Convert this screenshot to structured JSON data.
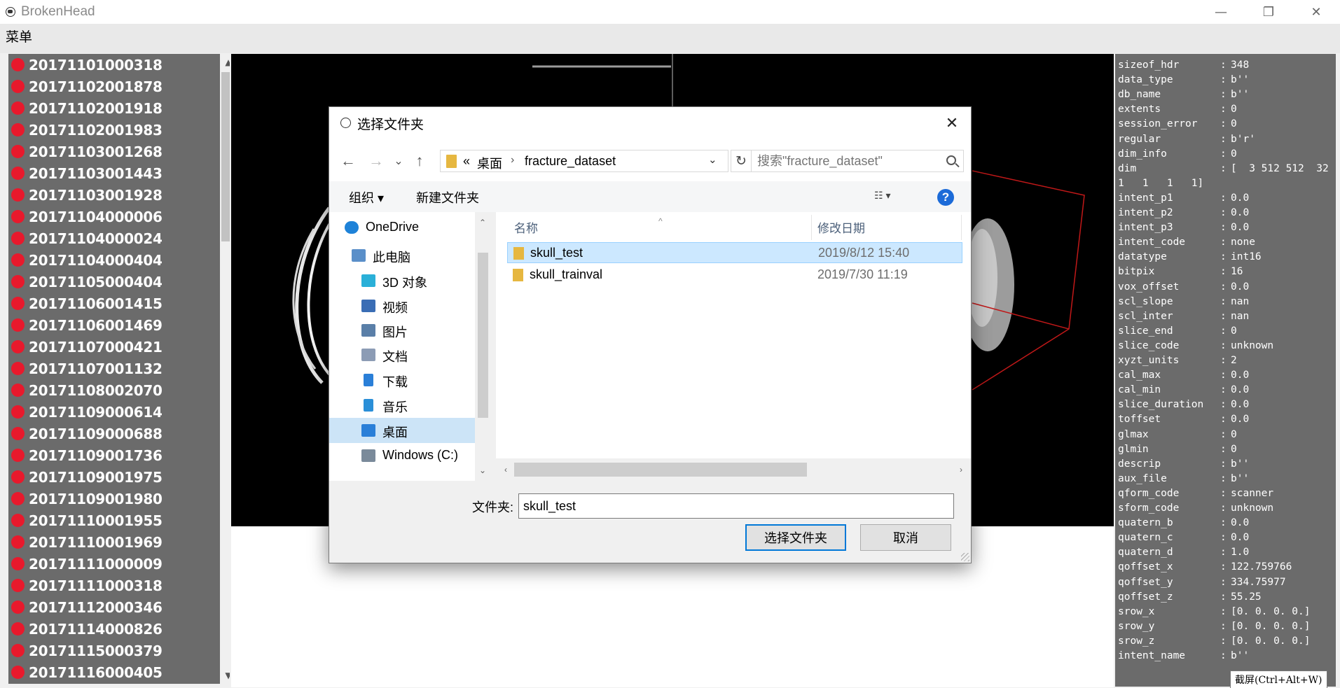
{
  "app": {
    "title": "BrokenHead"
  },
  "window_controls": {
    "minimize": "—",
    "restore": "❐",
    "close": "✕"
  },
  "menu": {
    "label": "菜单"
  },
  "case_list": [
    "20171101000318",
    "20171102001878",
    "20171102001918",
    "20171102001983",
    "20171103001268",
    "20171103001443",
    "20171103001928",
    "20171104000006",
    "20171104000024",
    "20171104000404",
    "20171105000404",
    "20171106001415",
    "20171106001469",
    "20171107000421",
    "20171107001132",
    "20171108002070",
    "20171109000614",
    "20171109000688",
    "20171109001736",
    "20171109001975",
    "20171109001980",
    "20171110001955",
    "20171110001969",
    "20171111000009",
    "20171111000318",
    "20171112000346",
    "20171114000826",
    "20171115000379",
    "20171116000405"
  ],
  "header_info": [
    {
      "k": "sizeof_hdr",
      "v": "348"
    },
    {
      "k": "data_type",
      "v": "b''"
    },
    {
      "k": "db_name",
      "v": "b''"
    },
    {
      "k": "extents",
      "v": "0"
    },
    {
      "k": "session_error",
      "v": "0"
    },
    {
      "k": "regular",
      "v": "b'r'"
    },
    {
      "k": "dim_info",
      "v": "0"
    },
    {
      "k": "dim",
      "v": "[  3 512 512  32"
    },
    {
      "k": "",
      "v": "1   1   1   1]",
      "cont": true
    },
    {
      "k": "intent_p1",
      "v": "0.0"
    },
    {
      "k": "intent_p2",
      "v": "0.0"
    },
    {
      "k": "intent_p3",
      "v": "0.0"
    },
    {
      "k": "intent_code",
      "v": "none"
    },
    {
      "k": "datatype",
      "v": "int16"
    },
    {
      "k": "bitpix",
      "v": "16"
    },
    {
      "k": "vox_offset",
      "v": "0.0"
    },
    {
      "k": "scl_slope",
      "v": "nan"
    },
    {
      "k": "scl_inter",
      "v": "nan"
    },
    {
      "k": "slice_end",
      "v": "0"
    },
    {
      "k": "slice_code",
      "v": "unknown"
    },
    {
      "k": "xyzt_units",
      "v": "2"
    },
    {
      "k": "cal_max",
      "v": "0.0"
    },
    {
      "k": "cal_min",
      "v": "0.0"
    },
    {
      "k": "slice_duration",
      "v": "0.0"
    },
    {
      "k": "toffset",
      "v": "0.0"
    },
    {
      "k": "glmax",
      "v": "0"
    },
    {
      "k": "glmin",
      "v": "0"
    },
    {
      "k": "descrip",
      "v": "b''"
    },
    {
      "k": "aux_file",
      "v": "b''"
    },
    {
      "k": "qform_code",
      "v": "scanner"
    },
    {
      "k": "sform_code",
      "v": "unknown"
    },
    {
      "k": "quatern_b",
      "v": "0.0"
    },
    {
      "k": "quatern_c",
      "v": "0.0"
    },
    {
      "k": "quatern_d",
      "v": "1.0"
    },
    {
      "k": "qoffset_x",
      "v": "122.759766"
    },
    {
      "k": "qoffset_y",
      "v": "334.75977"
    },
    {
      "k": "qoffset_z",
      "v": "55.25"
    },
    {
      "k": "srow_x",
      "v": "[0. 0. 0. 0.]"
    },
    {
      "k": "srow_y",
      "v": "[0. 0. 0. 0.]"
    },
    {
      "k": "srow_z",
      "v": "[0. 0. 0. 0.]"
    },
    {
      "k": "intent_name",
      "v": "b''"
    }
  ],
  "header_separator": ":",
  "tooltip": "截屏(Ctrl+Alt+W)",
  "dialog": {
    "title": "选择文件夹",
    "close": "✕",
    "nav": {
      "back": "←",
      "forward": "→",
      "recent": "⌄",
      "up": "↑"
    },
    "address": {
      "overflow": "«",
      "crumb1": "桌面",
      "chevron": "›",
      "crumb2": "fracture_dataset",
      "dropdown": "⌄"
    },
    "refresh": "↻",
    "search_placeholder": "搜索\"fracture_dataset\"",
    "toolbar": {
      "organize": "组织 ▾",
      "new_folder": "新建文件夹",
      "view": "☷ ▾",
      "help": "?"
    },
    "nav_pane": [
      {
        "label": "OneDrive",
        "icon": "cloud-icon"
      },
      {
        "label": "此电脑",
        "icon": "pc-icon"
      },
      {
        "label": "3D 对象",
        "icon": "cube-icon"
      },
      {
        "label": "视频",
        "icon": "video-icon"
      },
      {
        "label": "图片",
        "icon": "picture-icon"
      },
      {
        "label": "文档",
        "icon": "document-icon"
      },
      {
        "label": "下载",
        "icon": "download-icon"
      },
      {
        "label": "音乐",
        "icon": "music-icon"
      },
      {
        "label": "桌面",
        "icon": "desktop-icon",
        "selected": true
      },
      {
        "label": "Windows (C:)",
        "icon": "drive-icon"
      }
    ],
    "columns": {
      "name": "名称",
      "date": "修改日期",
      "sort_indicator": "^"
    },
    "files": [
      {
        "name": "skull_test",
        "date": "2019/8/12 15:40",
        "selected": true
      },
      {
        "name": "skull_trainval",
        "date": "2019/7/30 11:19"
      }
    ],
    "folder_label": "文件夹:",
    "folder_value": "skull_test",
    "ok_button": "选择文件夹",
    "cancel_button": "取消",
    "colors": {
      "accent": "#0078d7",
      "selection": "#cce8ff",
      "folder": "#e6b740"
    }
  },
  "colors": {
    "panel_bg": "#6b6b6b",
    "status_dot": "#e8192c",
    "viewer_bg": "#000000"
  }
}
